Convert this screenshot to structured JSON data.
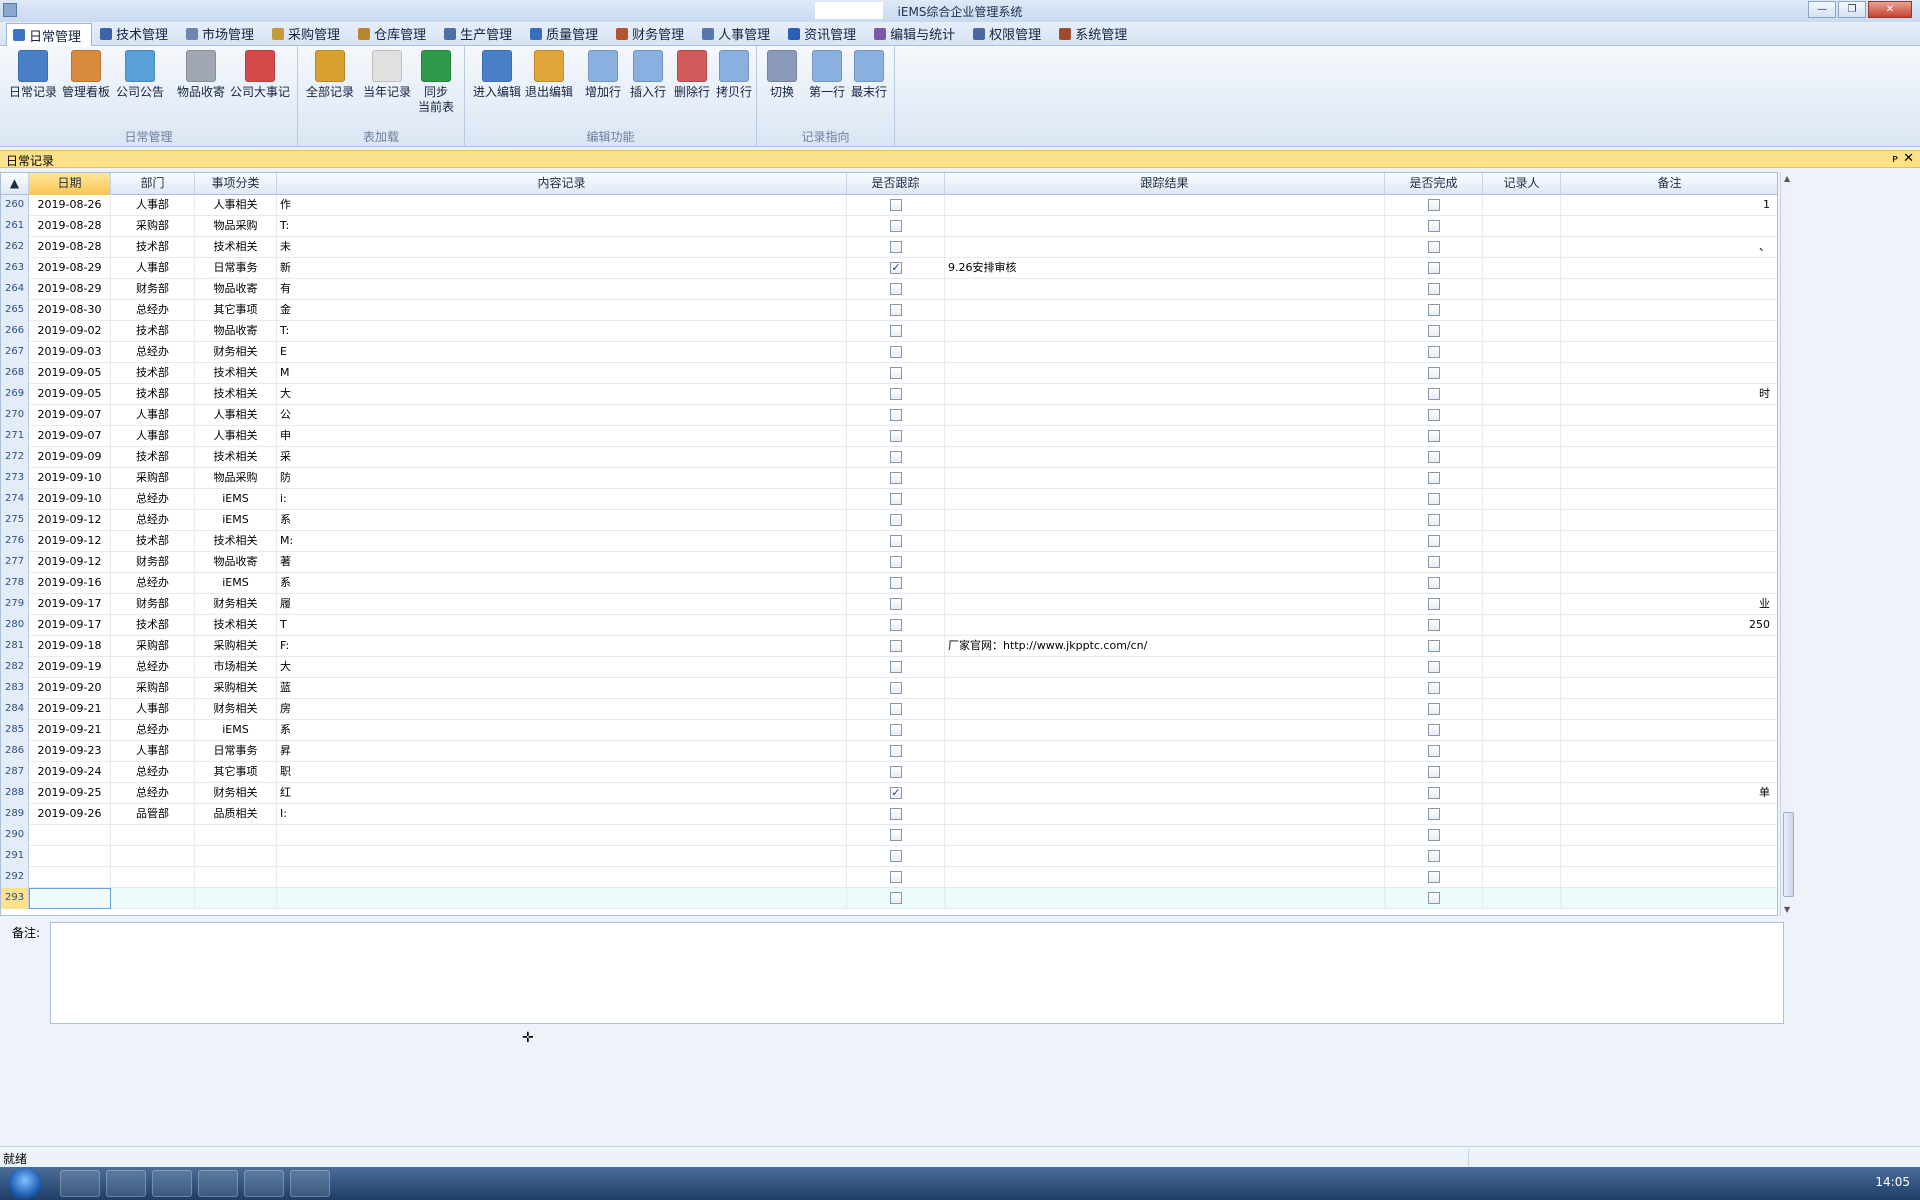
{
  "window": {
    "title": "iEMS综合企业管理系统"
  },
  "menu": [
    {
      "label": "日常管理",
      "icon": "daily-icon",
      "color": "#3b73c4",
      "active": true
    },
    {
      "label": "技术管理",
      "icon": "tech-icon",
      "color": "#3f63a8"
    },
    {
      "label": "市场管理",
      "icon": "chart-icon",
      "color": "#6f86b0"
    },
    {
      "label": "采购管理",
      "icon": "scale-icon",
      "color": "#c59a3a"
    },
    {
      "label": "仓库管理",
      "icon": "warehouse-icon",
      "color": "#b8862e"
    },
    {
      "label": "生产管理",
      "icon": "production-icon",
      "color": "#4d6fa8"
    },
    {
      "label": "质量管理",
      "icon": "quality-icon",
      "color": "#3a6dbb"
    },
    {
      "label": "财务管理",
      "icon": "finance-icon",
      "color": "#b3542f"
    },
    {
      "label": "人事管理",
      "icon": "people-icon",
      "color": "#5577aa"
    },
    {
      "label": "资讯管理",
      "icon": "info-icon",
      "color": "#2a5fb3"
    },
    {
      "label": "编辑与统计",
      "icon": "edit-stat-icon",
      "color": "#7d56a8"
    },
    {
      "label": "权限管理",
      "icon": "permission-icon",
      "color": "#4a6a9e"
    },
    {
      "label": "系统管理",
      "icon": "system-icon",
      "color": "#a04a30"
    }
  ],
  "ribbon": {
    "groups": [
      {
        "title": "日常管理",
        "buttons": [
          "日常记录",
          "管理看板",
          "公司公告",
          "物品收寄",
          "公司大事记"
        ]
      },
      {
        "title": "表加载",
        "buttons": [
          "全部记录",
          "当年记录",
          "同步\n当前表"
        ]
      },
      {
        "title": "编辑功能",
        "buttons": [
          "进入编辑",
          "退出编辑",
          "增加行",
          "插入行",
          "删除行",
          "拷贝行"
        ]
      },
      {
        "title": "记录指向",
        "buttons": [
          "切换",
          "第一行",
          "最末行"
        ]
      }
    ],
    "button_colors": [
      "#4a7fc8",
      "#d98a3a",
      "#58a0d8",
      "#a0a7b3",
      "#d44a4a",
      "#d9a030",
      "#e0e0e0",
      "#2e9a4a",
      "#4a7fc8",
      "#e2a53a",
      "#8ab0df",
      "#8ab0df",
      "#d25a5a",
      "#8ab0df",
      "#8a9ab8",
      "#8ab0df",
      "#8ab0df"
    ]
  },
  "doc": {
    "title": "日常记录",
    "pin": "ᴘ",
    "close": "✕"
  },
  "grid": {
    "headers": [
      "▲",
      "日期",
      "部门",
      "事项分类",
      "内容记录",
      "是否跟踪",
      "跟踪结果",
      "是否完成",
      "记录人",
      "备注"
    ],
    "rows": [
      {
        "n": "260",
        "date": "2019-08-26",
        "dept": "人事部",
        "cat": "人事相关",
        "content": "作",
        "track": false,
        "result": "",
        "done": false,
        "note": "1"
      },
      {
        "n": "261",
        "date": "2019-08-28",
        "dept": "采购部",
        "cat": "物品采购",
        "content": "T:",
        "track": false,
        "result": "",
        "done": false,
        "note": ""
      },
      {
        "n": "262",
        "date": "2019-08-28",
        "dept": "技术部",
        "cat": "技术相关",
        "content": "未",
        "track": false,
        "result": "",
        "done": false,
        "note": "、"
      },
      {
        "n": "263",
        "date": "2019-08-29",
        "dept": "人事部",
        "cat": "日常事务",
        "content": "新",
        "track": true,
        "result": "9.26安排审核",
        "done": false,
        "note": ""
      },
      {
        "n": "264",
        "date": "2019-08-29",
        "dept": "财务部",
        "cat": "物品收寄",
        "content": "有",
        "track": false,
        "result": "",
        "done": false,
        "note": ""
      },
      {
        "n": "265",
        "date": "2019-08-30",
        "dept": "总经办",
        "cat": "其它事项",
        "content": "金",
        "track": false,
        "result": "",
        "done": false,
        "note": ""
      },
      {
        "n": "266",
        "date": "2019-09-02",
        "dept": "技术部",
        "cat": "物品收寄",
        "content": "T:",
        "track": false,
        "result": "",
        "done": false,
        "note": ""
      },
      {
        "n": "267",
        "date": "2019-09-03",
        "dept": "总经办",
        "cat": "财务相关",
        "content": "E",
        "track": false,
        "result": "",
        "done": false,
        "note": ""
      },
      {
        "n": "268",
        "date": "2019-09-05",
        "dept": "技术部",
        "cat": "技术相关",
        "content": "M",
        "track": false,
        "result": "",
        "done": false,
        "note": ""
      },
      {
        "n": "269",
        "date": "2019-09-05",
        "dept": "技术部",
        "cat": "技术相关",
        "content": "大",
        "track": false,
        "result": "",
        "done": false,
        "note": "时"
      },
      {
        "n": "270",
        "date": "2019-09-07",
        "dept": "人事部",
        "cat": "人事相关",
        "content": "公",
        "track": false,
        "result": "",
        "done": false,
        "note": ""
      },
      {
        "n": "271",
        "date": "2019-09-07",
        "dept": "人事部",
        "cat": "人事相关",
        "content": "申",
        "track": false,
        "result": "",
        "done": false,
        "note": ""
      },
      {
        "n": "272",
        "date": "2019-09-09",
        "dept": "技术部",
        "cat": "技术相关",
        "content": "采",
        "track": false,
        "result": "",
        "done": false,
        "note": ""
      },
      {
        "n": "273",
        "date": "2019-09-10",
        "dept": "采购部",
        "cat": "物品采购",
        "content": "防",
        "track": false,
        "result": "",
        "done": false,
        "note": ""
      },
      {
        "n": "274",
        "date": "2019-09-10",
        "dept": "总经办",
        "cat": "iEMS",
        "content": "i:",
        "track": false,
        "result": "",
        "done": false,
        "note": ""
      },
      {
        "n": "275",
        "date": "2019-09-12",
        "dept": "总经办",
        "cat": "iEMS",
        "content": "系",
        "track": false,
        "result": "",
        "done": false,
        "note": ""
      },
      {
        "n": "276",
        "date": "2019-09-12",
        "dept": "技术部",
        "cat": "技术相关",
        "content": "M:",
        "track": false,
        "result": "",
        "done": false,
        "note": ""
      },
      {
        "n": "277",
        "date": "2019-09-12",
        "dept": "财务部",
        "cat": "物品收寄",
        "content": "著",
        "track": false,
        "result": "",
        "done": false,
        "note": ""
      },
      {
        "n": "278",
        "date": "2019-09-16",
        "dept": "总经办",
        "cat": "iEMS",
        "content": "系",
        "track": false,
        "result": "",
        "done": false,
        "note": ""
      },
      {
        "n": "279",
        "date": "2019-09-17",
        "dept": "财务部",
        "cat": "财务相关",
        "content": "履",
        "track": false,
        "result": "",
        "done": false,
        "note": "业"
      },
      {
        "n": "280",
        "date": "2019-09-17",
        "dept": "技术部",
        "cat": "技术相关",
        "content": "T",
        "track": false,
        "result": "",
        "done": false,
        "note": "250"
      },
      {
        "n": "281",
        "date": "2019-09-18",
        "dept": "采购部",
        "cat": "采购相关",
        "content": "F:",
        "track": false,
        "result": "厂家官网：http://www.jkpptc.com/cn/",
        "done": false,
        "note": ""
      },
      {
        "n": "282",
        "date": "2019-09-19",
        "dept": "总经办",
        "cat": "市场相关",
        "content": "大",
        "track": false,
        "result": "",
        "done": false,
        "note": ""
      },
      {
        "n": "283",
        "date": "2019-09-20",
        "dept": "采购部",
        "cat": "采购相关",
        "content": "蓝",
        "track": false,
        "result": "",
        "done": false,
        "note": ""
      },
      {
        "n": "284",
        "date": "2019-09-21",
        "dept": "人事部",
        "cat": "财务相关",
        "content": "房",
        "track": false,
        "result": "",
        "done": false,
        "note": ""
      },
      {
        "n": "285",
        "date": "2019-09-21",
        "dept": "总经办",
        "cat": "iEMS",
        "content": "系",
        "track": false,
        "result": "",
        "done": false,
        "note": ""
      },
      {
        "n": "286",
        "date": "2019-09-23",
        "dept": "人事部",
        "cat": "日常事务",
        "content": "昇",
        "track": false,
        "result": "",
        "done": false,
        "note": ""
      },
      {
        "n": "287",
        "date": "2019-09-24",
        "dept": "总经办",
        "cat": "其它事项",
        "content": "职",
        "track": false,
        "result": "",
        "done": false,
        "note": ""
      },
      {
        "n": "288",
        "date": "2019-09-25",
        "dept": "总经办",
        "cat": "财务相关",
        "content": "红",
        "track": true,
        "result": "",
        "done": false,
        "note": "单"
      },
      {
        "n": "289",
        "date": "2019-09-26",
        "dept": "品管部",
        "cat": "品质相关",
        "content": "I:",
        "track": false,
        "result": "",
        "done": false,
        "note": ""
      },
      {
        "n": "290",
        "date": "",
        "dept": "",
        "cat": "",
        "content": "",
        "track": false,
        "result": "",
        "done": false,
        "note": ""
      },
      {
        "n": "291",
        "date": "",
        "dept": "",
        "cat": "",
        "content": "",
        "track": false,
        "result": "",
        "done": false,
        "note": ""
      },
      {
        "n": "292",
        "date": "",
        "dept": "",
        "cat": "",
        "content": "",
        "track": false,
        "result": "",
        "done": false,
        "note": ""
      },
      {
        "n": "293",
        "date": "",
        "dept": "",
        "cat": "",
        "content": "",
        "track": false,
        "result": "",
        "done": false,
        "note": ""
      }
    ]
  },
  "notes": {
    "label": "备注:"
  },
  "status": {
    "text": "就绪"
  },
  "taskbar": {
    "time": "14:05",
    "apps": [
      "search-app",
      "xmind-app",
      "editor-app",
      "explorer-app",
      "chrome-app",
      "iems-app"
    ]
  }
}
